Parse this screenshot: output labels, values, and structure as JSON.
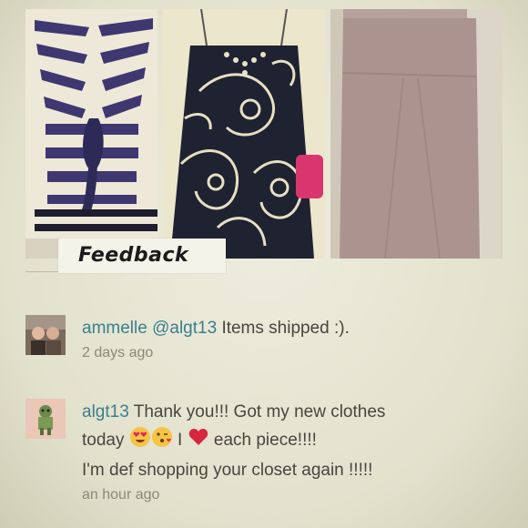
{
  "section": {
    "title": "Feedback"
  },
  "comments": [
    {
      "username": "ammelle",
      "mention": "@algt13",
      "text": "Items shipped :).",
      "time": "2 days ago"
    },
    {
      "username": "algt13",
      "line1_text": "Thank you!!! Got my new clothes",
      "line2_start": "today",
      "line2_i": "I",
      "line2_end": "each piece!!!!",
      "line3": "I'm def shopping your closet again !!!!!",
      "time": "an hour ago"
    }
  ],
  "icons": [
    "heart-eyes-emoji-icon",
    "kissing-face-emoji-icon",
    "red-heart-emoji-icon"
  ],
  "colors": {
    "username": "#3a7f8e",
    "background": "#e4e3cf"
  }
}
